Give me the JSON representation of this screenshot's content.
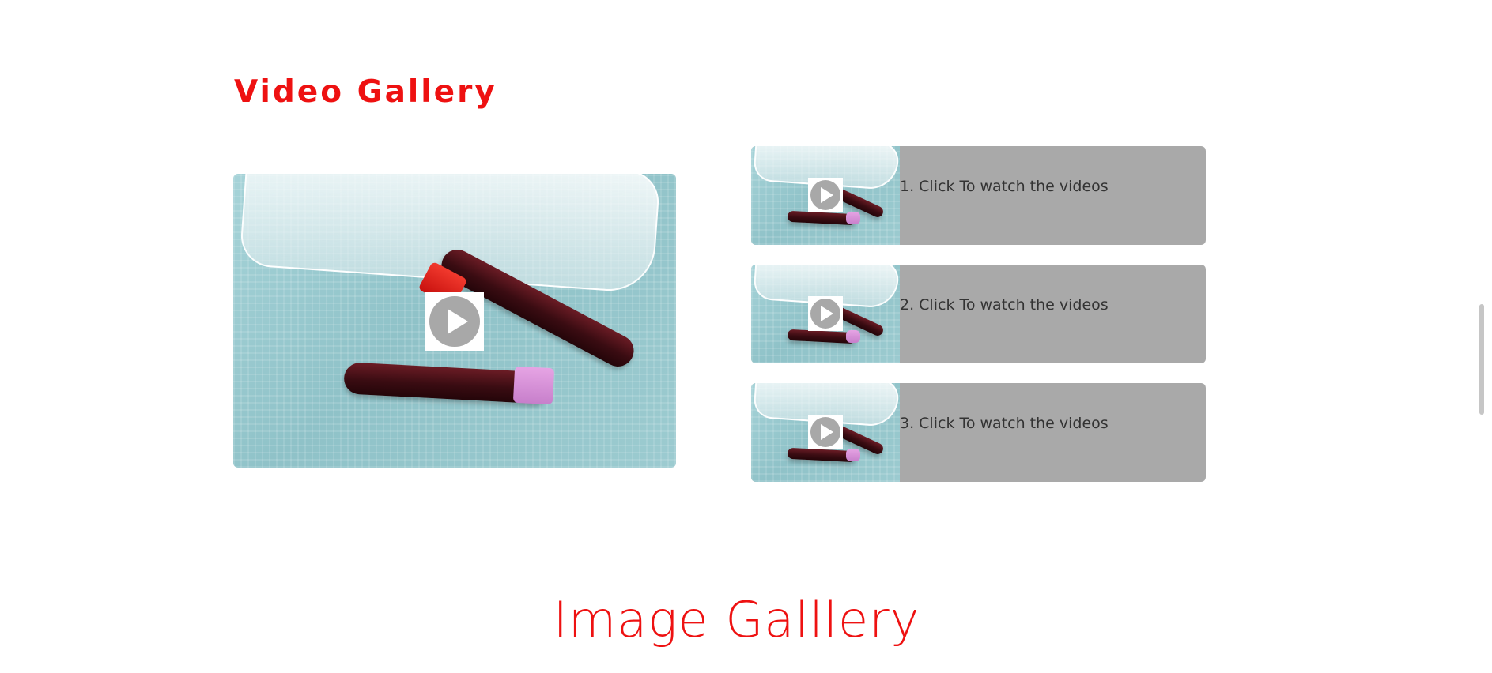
{
  "video_gallery": {
    "title": "Video Gallery",
    "main_video": {
      "thumbnail_icon": "play-icon"
    },
    "items": [
      {
        "label": "1. Click To watch the videos",
        "icon": "play-icon"
      },
      {
        "label": "2. Click To watch the videos",
        "icon": "play-icon"
      },
      {
        "label": "3. Click To watch the videos",
        "icon": "play-icon"
      }
    ]
  },
  "image_gallery": {
    "title": "Image Galllery"
  },
  "colors": {
    "accent": "#ee1111",
    "item_background": "#a9a9a9",
    "play_icon": "#a8a8a8"
  }
}
